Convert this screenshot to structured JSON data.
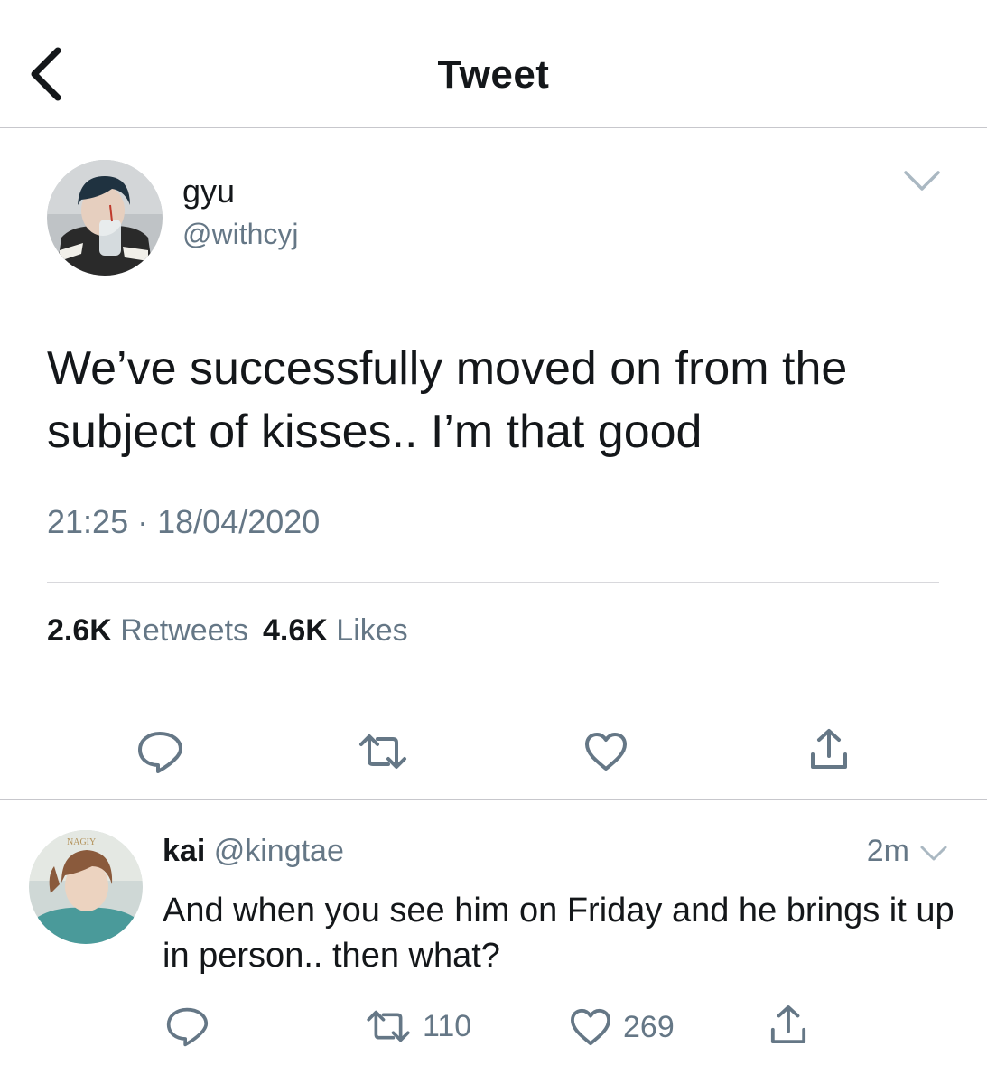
{
  "header": {
    "title": "Tweet",
    "back_icon": "chevron-left-icon"
  },
  "main_tweet": {
    "display_name": "gyu",
    "handle": "@withcyj",
    "text": "We’ve successfully moved on from the subject of kisses.. I’m that good",
    "time": "21:25",
    "separator": "·",
    "date": "18/04/2020",
    "retweet_count": "2.6K",
    "retweet_label": "Retweets",
    "like_count": "4.6K",
    "like_label": "Likes",
    "actions": [
      "reply-icon",
      "retweet-icon",
      "heart-icon",
      "share-icon"
    ]
  },
  "reply": {
    "display_name": "kai",
    "handle": "@kingtae",
    "time": "2m",
    "text": "And when you see him on Friday and he brings it up in person.. then what?",
    "retweets": "110",
    "likes": "269",
    "avatar_watermark": "NAGIY"
  },
  "colors": {
    "text": "#14171a",
    "secondary": "#657786",
    "divider": "#c7c7cc",
    "background": "#ffffff"
  }
}
